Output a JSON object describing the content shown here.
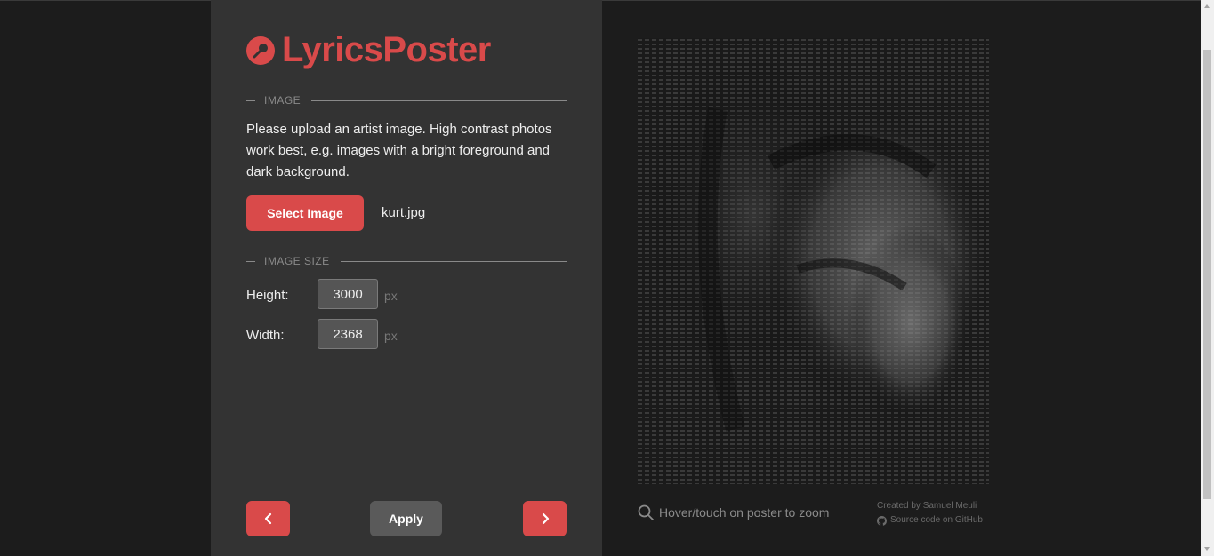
{
  "app": {
    "logo_text": "LyricsPoster",
    "accent_color": "#d94a4a"
  },
  "image_section": {
    "title": "IMAGE",
    "description": "Please upload an artist image. High contrast photos work best, e.g. images with a bright foreground and dark background.",
    "select_label": "Select Image",
    "filename": "kurt.jpg"
  },
  "size_section": {
    "title": "IMAGE SIZE",
    "height_label": "Height:",
    "height_value": "3000",
    "width_label": "Width:",
    "width_value": "2368",
    "unit": "px"
  },
  "nav": {
    "prev_icon": "chevron-left-icon",
    "next_icon": "chevron-right-icon",
    "apply_label": "Apply"
  },
  "preview": {
    "zoom_hint": "Hover/touch on poster to zoom",
    "credit": "Created by Samuel Meuli",
    "source_link": "Source code on GitHub"
  }
}
